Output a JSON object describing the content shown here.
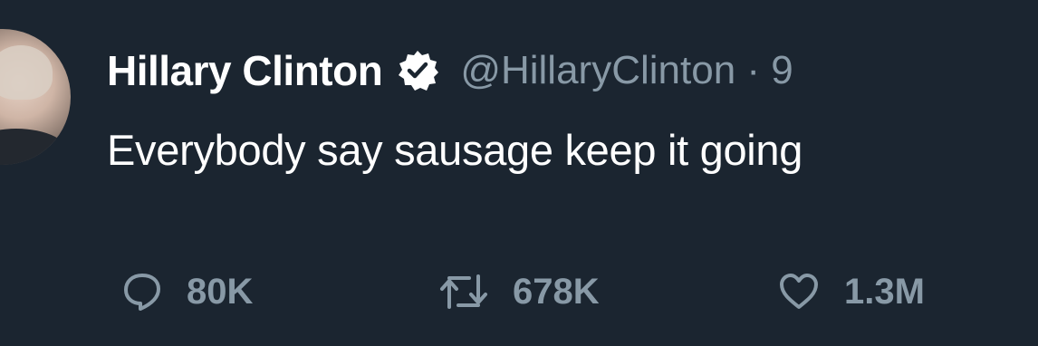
{
  "tweet": {
    "author_name": "Hillary Clinton",
    "handle": "@HillaryClinton · 9",
    "text": "Everybody say sausage keep it going",
    "verified_icon": "verified-badge-icon"
  },
  "actions": {
    "reply": {
      "icon": "reply-icon",
      "count": "80K"
    },
    "retweet": {
      "icon": "retweet-icon",
      "count": "678K"
    },
    "like": {
      "icon": "heart-icon",
      "count": "1.3M"
    }
  },
  "colors": {
    "background": "#1b2530",
    "primary_text": "#ffffff",
    "secondary_text": "#8899a6"
  }
}
